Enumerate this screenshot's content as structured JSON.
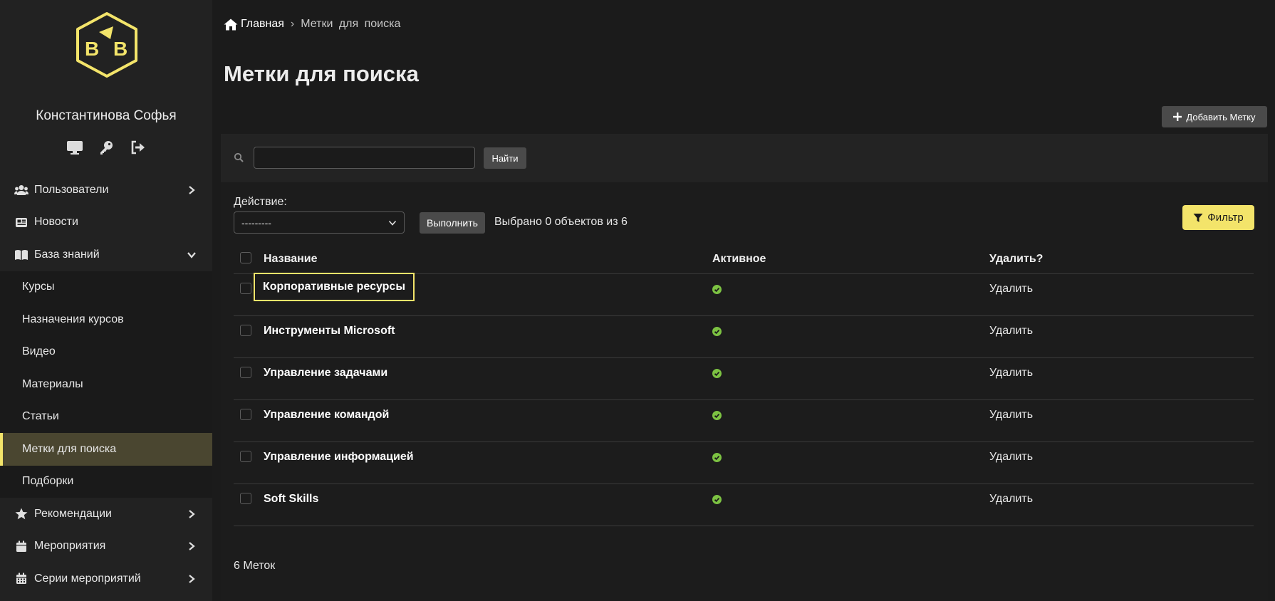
{
  "sidebar": {
    "user_name": "Константинова Софья",
    "user_icons": [
      "monitor-icon",
      "key-icon",
      "logout-icon"
    ],
    "items": [
      {
        "label": "Пользователи",
        "icon": "users-icon",
        "chevron": "right"
      },
      {
        "label": "Новости",
        "icon": "newspaper-icon",
        "chevron": "none"
      },
      {
        "label": "База знаний",
        "icon": "book-icon",
        "chevron": "down"
      }
    ],
    "sub_items": [
      {
        "label": "Курсы",
        "active": false
      },
      {
        "label": "Назначения курсов",
        "active": false
      },
      {
        "label": "Видео",
        "active": false
      },
      {
        "label": "Материалы",
        "active": false
      },
      {
        "label": "Статьи",
        "active": false
      },
      {
        "label": "Метки для поиска",
        "active": true
      },
      {
        "label": "Подборки",
        "active": false
      }
    ],
    "items_after": [
      {
        "label": "Рекомендации",
        "icon": "star-icon",
        "chevron": "right"
      },
      {
        "label": "Мероприятия",
        "icon": "calendar-icon",
        "chevron": "right"
      },
      {
        "label": "Серии мероприятий",
        "icon": "calendar-grid-icon",
        "chevron": "right"
      }
    ]
  },
  "breadcrumb": {
    "home": "Главная",
    "separator": "›",
    "current": "Метки для поиска"
  },
  "page_title": "Метки для поиска",
  "add_button": "Добавить Метку",
  "search": {
    "value": "",
    "placeholder": "",
    "button": "Найти"
  },
  "actions": {
    "label": "Действие:",
    "selected": "---------",
    "execute": "Выполнить",
    "selected_info": "Выбрано 0 объектов из 6"
  },
  "filter_button": "Фильтр",
  "table": {
    "columns": [
      "Название",
      "Активное",
      "Удалить?"
    ],
    "rows": [
      {
        "name": "Корпоративные ресурсы",
        "active": true,
        "delete": "Удалить"
      },
      {
        "name": "Инструменты Microsoft",
        "active": true,
        "delete": "Удалить"
      },
      {
        "name": "Управление задачами",
        "active": true,
        "delete": "Удалить"
      },
      {
        "name": "Управление командой",
        "active": true,
        "delete": "Удалить"
      },
      {
        "name": "Управление информацией",
        "active": true,
        "delete": "Удалить"
      },
      {
        "name": "Soft Skills",
        "active": true,
        "delete": "Удалить"
      }
    ],
    "focused_row": 0
  },
  "count_text": "6 Меток",
  "colors": {
    "accent": "#f3e46a",
    "active_bg": "#4a4630",
    "check_green": "#7cc242",
    "sidebar_bg": "#222222",
    "page_bg": "#1b1b1b"
  }
}
